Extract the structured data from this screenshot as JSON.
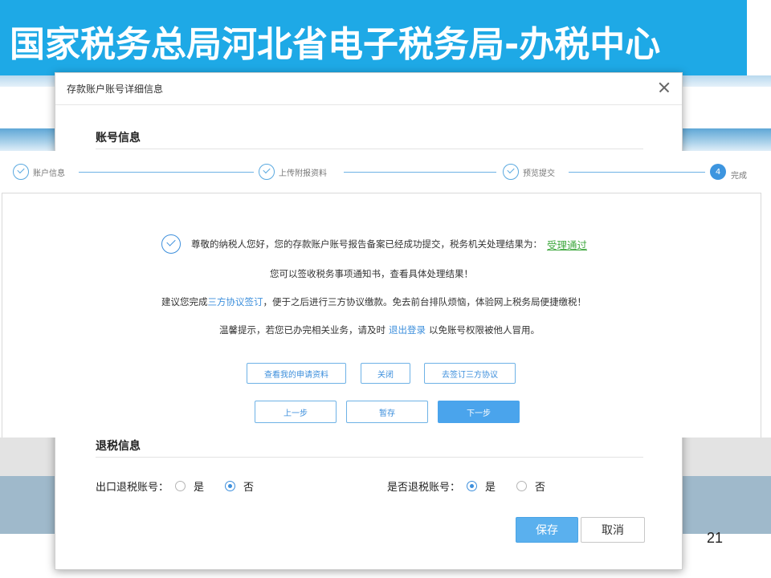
{
  "slide_title": "国家税务总局河北省电子税务局-办税中心",
  "page_number": "21",
  "dialog": {
    "title": "存款账户账号详细信息",
    "section_account": "账号信息",
    "section_refund": "退税信息",
    "export_refund_label": "出口退税账号：",
    "refund_account_label": "是否退税账号：",
    "yes": "是",
    "no": "否",
    "export_refund_selected": "否",
    "refund_account_selected": "是",
    "save_label": "保存",
    "cancel_label": "取消"
  },
  "steps": [
    {
      "label": "账户信息",
      "status": "done"
    },
    {
      "label": "上传附报资料",
      "status": "done"
    },
    {
      "label": "预览提交",
      "status": "done"
    },
    {
      "label": "完成",
      "number": "4",
      "status": "current"
    }
  ],
  "result": {
    "line1": "尊敬的纳税人您好，您的存款账户账号报告备案已经成功提交，税务机关处理结果为：",
    "status": "受理通过",
    "line2": "您可以签收税务事项通知书，查看具体处理结果！",
    "line3_prefix": "建议您完成",
    "line3_link": "三方协议签订",
    "line3_suffix": "，便于之后进行三方协议缴款。免去前台排队烦恼，体验网上税务局便捷缴税！",
    "line4_prefix": "温馨提示，若您已办完相关业务，请及时",
    "line4_link": "退出登录",
    "line4_suffix": "以免账号权限被他人冒用。"
  },
  "actions": {
    "view_application": "查看我的申请资料",
    "close": "关闭",
    "sign_agreement": "去签订三方协议"
  },
  "nav": {
    "prev": "上一步",
    "save_draft": "暂存",
    "next": "下一步"
  },
  "colors": {
    "banner": "#1ea9e6",
    "accent_blue": "#3d8fdc",
    "success_green": "#3fa83f"
  }
}
